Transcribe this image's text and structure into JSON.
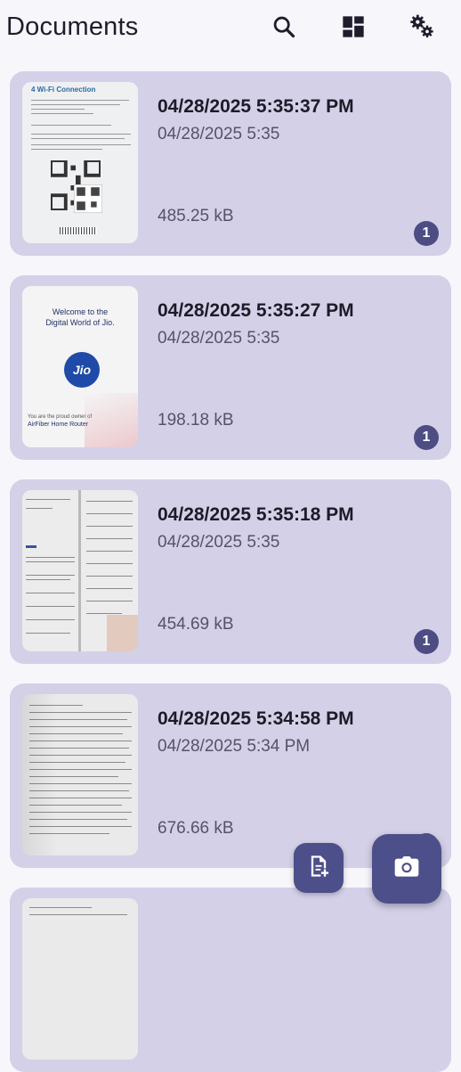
{
  "header": {
    "title": "Documents",
    "icons": [
      "search-icon",
      "grid-view-icon",
      "settings-icon"
    ]
  },
  "documents": [
    {
      "name": "04/28/2025 5:35:37 PM",
      "timestamp": "04/28/2025 5:35",
      "size": "485.25 kB",
      "pages": "1",
      "thumb_title": "4 Wi-Fi Connection"
    },
    {
      "name": "04/28/2025 5:35:27 PM",
      "timestamp": "04/28/2025 5:35",
      "size": "198.18 kB",
      "pages": "1",
      "thumb_heading1": "Welcome to the",
      "thumb_heading2": "Digital World of Jio.",
      "thumb_logo": "Jio",
      "thumb_foot1": "You are the proud owner of",
      "thumb_foot2": "AirFiber Home Router"
    },
    {
      "name": "04/28/2025 5:35:18 PM",
      "timestamp": "04/28/2025 5:35",
      "size": "454.69 kB",
      "pages": "1"
    },
    {
      "name": "04/28/2025 5:34:58 PM",
      "timestamp": "04/28/2025 5:34 PM",
      "size": "676.66 kB",
      "pages": "1"
    }
  ],
  "fab": {
    "new_document_icon": "note-add-icon",
    "camera_icon": "camera-icon"
  },
  "colors": {
    "card": "#d3d0e8",
    "accent": "#4d4f8a",
    "background": "#f7f6fb"
  }
}
